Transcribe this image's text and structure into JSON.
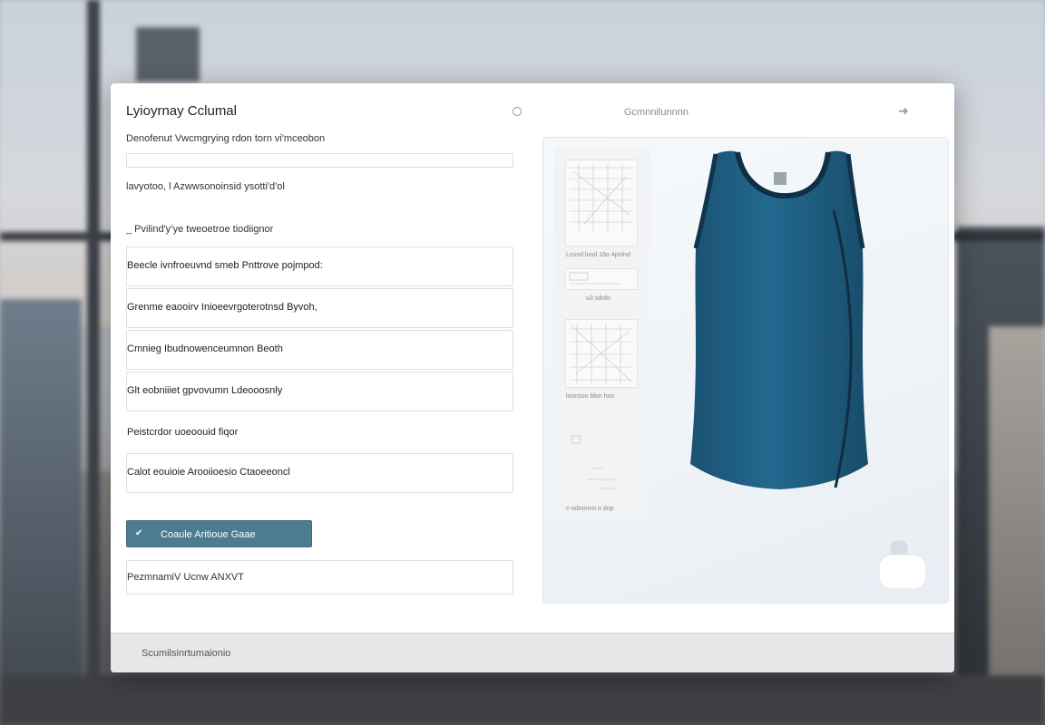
{
  "window": {
    "title": "Lyioyrnay Cclumal",
    "header_link": "Gcmnnilunnnn",
    "radio_icon": "radio-icon",
    "arrow_icon": "arrow-right-icon"
  },
  "form": {
    "field1_label": "Denofenut Vwcmgrying rdon torn vi'mceobon",
    "field2_label": "lavyotoo, l Azwwsonoinsid ysotti'd'ol",
    "field3_label": "_ Pvilind'y’ye tweoetroe tiodiignor",
    "rows": [
      "Beecle ivnfroeuvnd smeb  Pnttrove pojmpod:",
      "Grenme eaooirv Inioeevrgoterotnsd Byvoh,",
      "Cmnieg Ibudnowenceumnon Beoth",
      "Glt eobniiiet gpvovumn Ldeooosnly",
      "Peistcrdor uoeoouid fiqor",
      "Calot eouioie Arooiioesio Ctaoeeoncl"
    ],
    "submit_label": "Coaule Aritioue Gaae",
    "chevron_icon": "chevron-down-icon",
    "footer_field": "PezmnamiV Ucnw ANXVT"
  },
  "status_bar": {
    "text": "Scumilsinrtumaionio"
  },
  "preview": {
    "thumbs": [
      {
        "caption": "Lnsod luod 16o 4pnlnd"
      },
      {
        "caption": "u3 sdnfo"
      },
      {
        "caption": "loonsoo blon hon"
      },
      {
        "caption": "c-odoonnn o dop"
      }
    ],
    "product_icon": "tank-top-image",
    "lock_icon": "lock-icon",
    "product_color": "#1f5f82"
  }
}
